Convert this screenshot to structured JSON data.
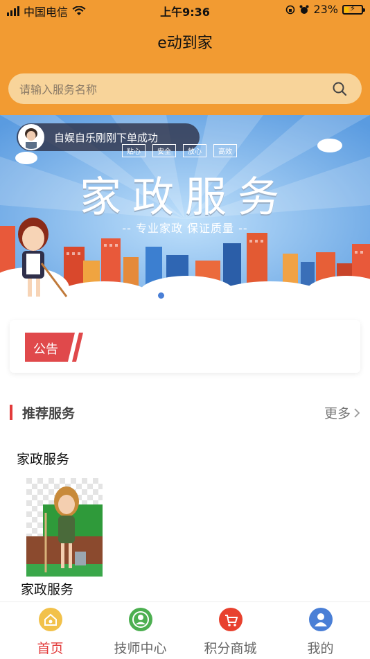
{
  "status_bar": {
    "carrier": "中国电信",
    "time": "上午9:36",
    "battery": "23%"
  },
  "app": {
    "title": "e动到家"
  },
  "search": {
    "placeholder": "请输入服务名称"
  },
  "banner": {
    "toast": "自娱自乐刚刚下单成功",
    "tags": [
      "贴心",
      "安全",
      "放心",
      "高效"
    ],
    "title": "家政服务",
    "subtitle": "-- 专业家政 保证质量 --"
  },
  "notice": {
    "label": "公告"
  },
  "recommended": {
    "title": "推荐服务",
    "more": "更多",
    "category": "家政服务",
    "items": [
      {
        "label": "家政服务"
      }
    ]
  },
  "tabbar": {
    "items": [
      {
        "label": "首页",
        "icon": "home-icon",
        "color": "#f2c14a",
        "active": true
      },
      {
        "label": "技师中心",
        "icon": "technician-icon",
        "color": "#4caf50",
        "active": false
      },
      {
        "label": "积分商城",
        "icon": "cart-icon",
        "color": "#e8412e",
        "active": false
      },
      {
        "label": "我的",
        "icon": "user-icon",
        "color": "#4a7fd6",
        "active": false
      }
    ]
  },
  "colors": {
    "header": "#f29b32",
    "accent": "#e23a3a",
    "search_bg": "#f8d49a"
  }
}
